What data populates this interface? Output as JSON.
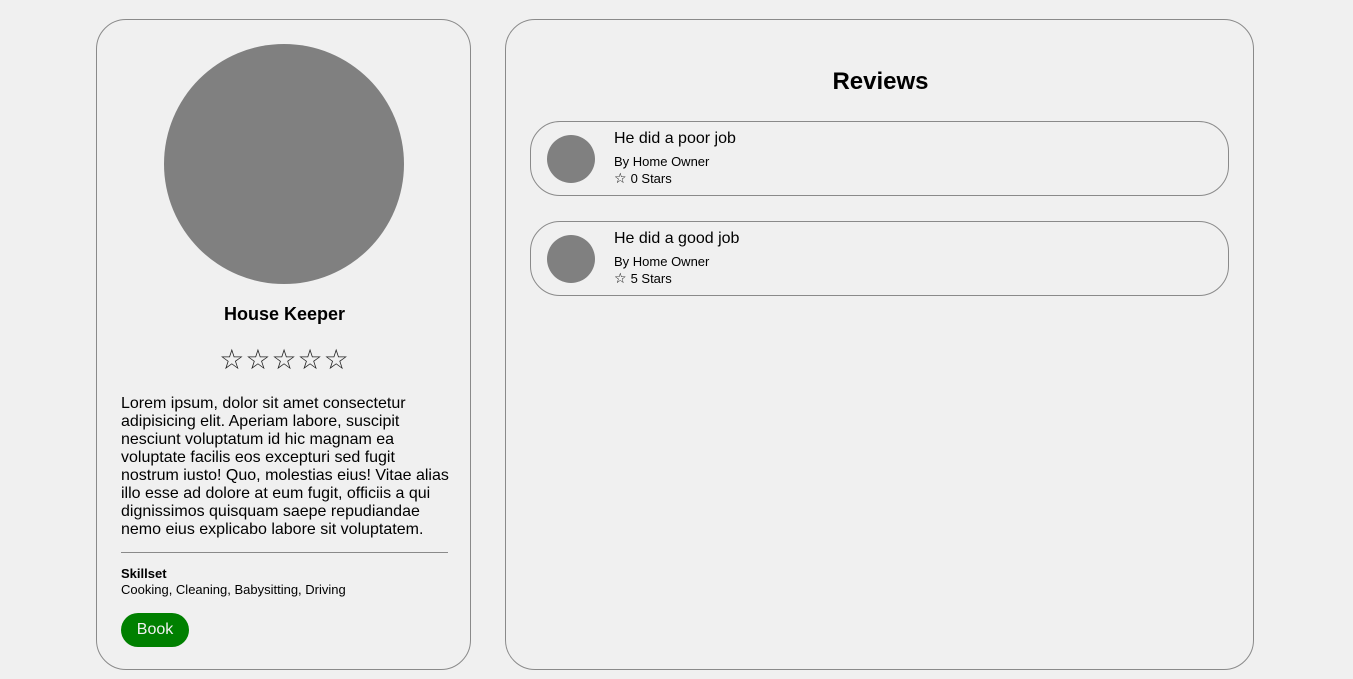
{
  "profile": {
    "name": "House Keeper",
    "rating": 0,
    "max_rating": 5,
    "stars": [
      "☆",
      "☆",
      "☆",
      "☆",
      "☆"
    ],
    "description": "Lorem ipsum, dolor sit amet consectetur adipisicing elit. Aperiam labore, suscipit nesciunt voluptatum id hic magnam ea voluptate facilis eos excepturi sed fugit nostrum iusto! Quo, molestias eius! Vitae alias illo esse ad dolore at eum fugit, officiis a qui dignissimos quisquam saepe repudiandae nemo eius explicabo labore sit voluptatem.",
    "skillset_heading": "Skillset",
    "skillset": "Cooking, Cleaning, Babysitting, Driving",
    "book_label": "Book"
  },
  "reviews": {
    "title": "Reviews",
    "items": [
      {
        "text": "He did a poor job",
        "author": "By Home Owner",
        "star_icon": "☆",
        "rating_label": "0 Stars"
      },
      {
        "text": "He did a good job",
        "author": "By Home Owner",
        "star_icon": "☆",
        "rating_label": "5 Stars"
      }
    ]
  },
  "colors": {
    "background": "#f0f0f0",
    "avatar": "#808080",
    "border": "#8a8a8a",
    "book_button": "#008000"
  }
}
